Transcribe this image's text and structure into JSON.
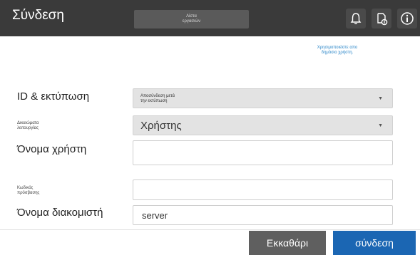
{
  "header": {
    "title": "Σύνδεση",
    "job_list_line1": "Λίστα",
    "job_list_line2": "εργασιών",
    "icons": [
      "bell-icon",
      "document-status-icon",
      "info-icon"
    ]
  },
  "public_user_link": {
    "line1": "Χρησιμοποιείστε απο",
    "line2": "δημόσιο χρήστη."
  },
  "form": {
    "id_print": {
      "label": "ID & εκτύπωση",
      "value_line1": "Αποσύνδεση μετά",
      "value_line2": "την εκτύπωση"
    },
    "function_permission": {
      "label_line1": "Δικαιώματα",
      "label_line2": "λειτουργίας",
      "value": "Χρήστης"
    },
    "username": {
      "label": "Όνομα χρήστη",
      "value": ""
    },
    "password": {
      "label_line1": "Κωδικός",
      "label_line2": "πρόσβασης",
      "value": ""
    },
    "server_name": {
      "label": "Όνομα διακομιστή",
      "value": "server"
    }
  },
  "footer": {
    "clear_label": "Εκκαθάρι",
    "login_label": "σύνδεση"
  },
  "colors": {
    "header_bg": "#3a3a3a",
    "clear_button": "#5f5f5f",
    "login_button": "#1b66b3",
    "link": "#2a86c8"
  }
}
